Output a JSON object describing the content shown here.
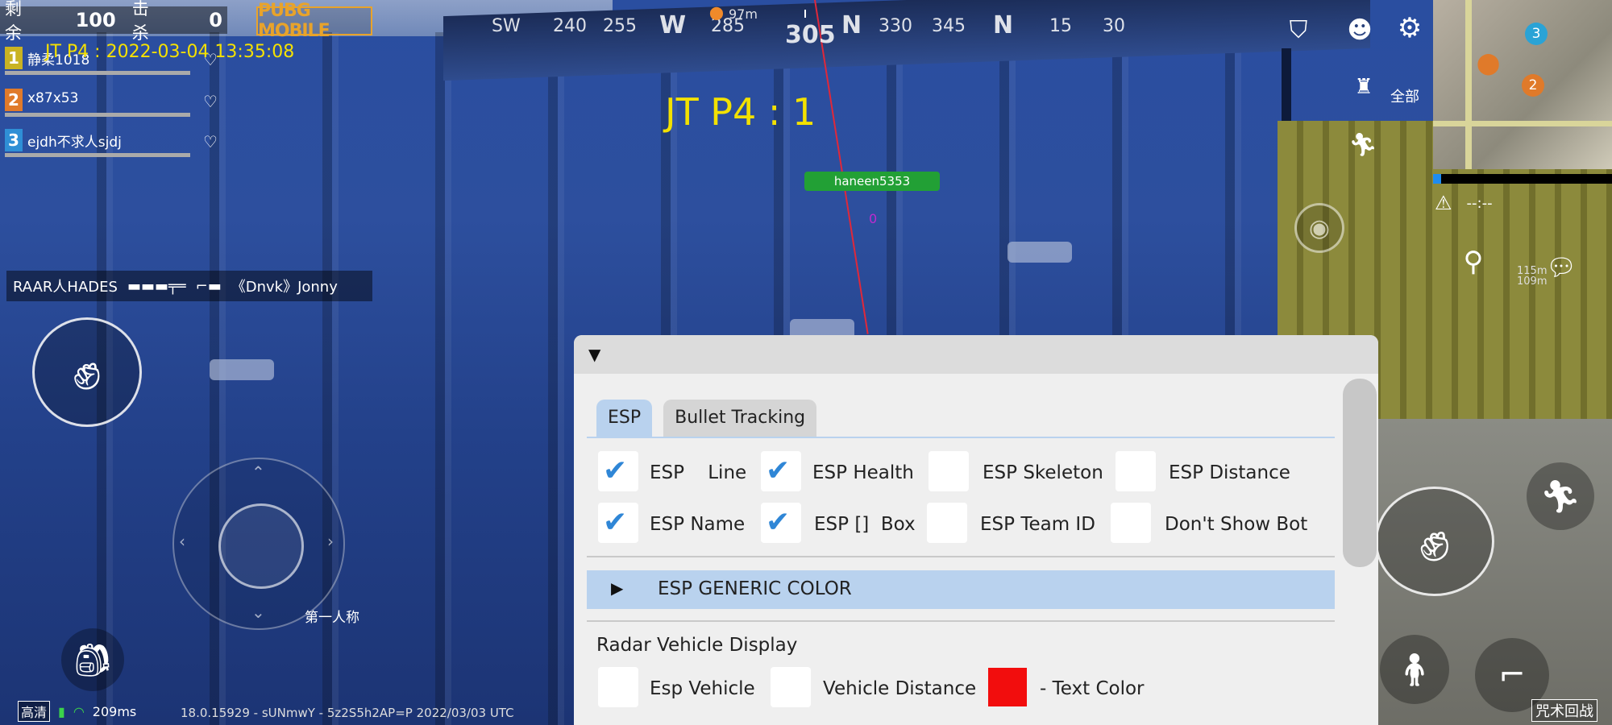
{
  "hud": {
    "remaining_label": "剩余",
    "remaining_value": "100",
    "kills_label": "击杀",
    "kills_value": "0",
    "game_logo": "PUBG MOBILE",
    "overlay_text": "JT P4 : 2022-03-04 13:35:08",
    "team": [
      {
        "index": "1",
        "name": "静柔1018"
      },
      {
        "index": "2",
        "name": "x87x53"
      },
      {
        "index": "3",
        "name": "ejdh不求人sjdj"
      }
    ],
    "killfeed": {
      "killer": "RAAR人HADES",
      "victim": "《Dnvk》Jonny"
    },
    "compass": {
      "labels": [
        "SW",
        "240",
        "255",
        "W",
        "285",
        "305",
        "N",
        "330",
        "345",
        "N",
        "15",
        "30"
      ],
      "marker_distance": "97m"
    },
    "jt_counter": "JT P4 : 1",
    "enemy_name": "haneen5353",
    "enemy_marker": "0",
    "map_all_label": "全部",
    "minimap_timer": "--:--",
    "markers": [
      "3",
      "2"
    ],
    "distance_readout": {
      "line1": "115m",
      "line2": "109m"
    },
    "first_person_label": "第一人称",
    "quality_label": "高清",
    "ping": "209ms",
    "build_text": "18.0.15929 - sUNmwY - 5z2S5h2AP=P 2022/03/03 UTC",
    "curse_label": "咒术回战"
  },
  "menu": {
    "tabs": [
      {
        "label": "ESP",
        "active": true
      },
      {
        "label": "Bullet Tracking",
        "active": false
      }
    ],
    "options_row1": [
      {
        "label": "ESP    Line",
        "checked": true
      },
      {
        "label": "ESP Health",
        "checked": true
      },
      {
        "label": "ESP Skeleton",
        "checked": false
      },
      {
        "label": "ESP Distance",
        "checked": false
      }
    ],
    "options_row2": [
      {
        "label": "ESP Name",
        "checked": true
      },
      {
        "label": "ESP []  Box",
        "checked": true
      },
      {
        "label": "ESP Team ID",
        "checked": false
      },
      {
        "label": "Don't Show Bot",
        "checked": false
      }
    ],
    "generic_color_label": "ESP GENERIC COLOR",
    "radar_section_label": "Radar Vehicle Display",
    "radar_options": [
      {
        "label": "Esp Vehicle",
        "checked": false
      },
      {
        "label": "Vehicle Distance",
        "checked": false
      }
    ],
    "text_color_label": "- Text Color",
    "text_color_value": "#f20d0d"
  },
  "colors": {
    "accent_blue": "#b9d2ee",
    "check_blue": "#2f86d6",
    "overlay_yellow": "#f3e100",
    "enemy_green": "#22a035"
  },
  "icons": {
    "checkmark": "check-icon",
    "collapse": "triangle-down-icon",
    "expand": "triangle-right-icon"
  }
}
